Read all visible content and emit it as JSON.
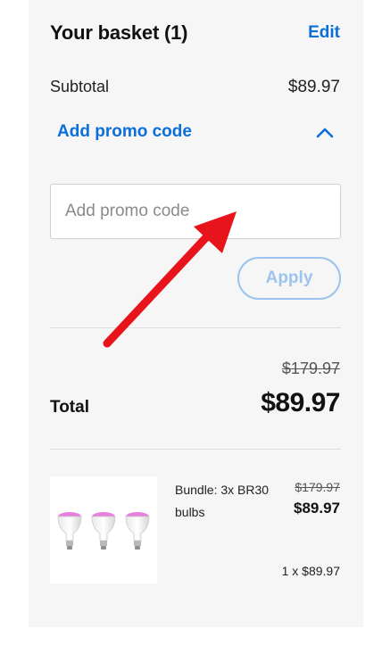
{
  "basket": {
    "title": "Your basket (1)",
    "edit_label": "Edit"
  },
  "summary": {
    "subtotal_label": "Subtotal",
    "subtotal_value": "$89.97",
    "original_total": "$179.97",
    "total_label": "Total",
    "total_value": "$89.97"
  },
  "promo": {
    "toggle_label": "Add promo code",
    "toggle_icon": "chevron-up-icon",
    "expanded": true,
    "input_value": "",
    "input_placeholder": "Add promo code",
    "apply_label": "Apply"
  },
  "items": [
    {
      "name": "Bundle: 3x BR30 bulbs",
      "original_price": "$179.97",
      "price": "$89.97",
      "quantity_line": "1 x $89.97",
      "image_icon": "light-bulbs-image"
    }
  ],
  "colors": {
    "accent": "#0a6fd8",
    "apply_disabled": "#9cc4ee",
    "panel_bg": "#f6f6f6",
    "annotation_arrow": "#e8141c",
    "bulb_glow": "#e46ad8"
  }
}
